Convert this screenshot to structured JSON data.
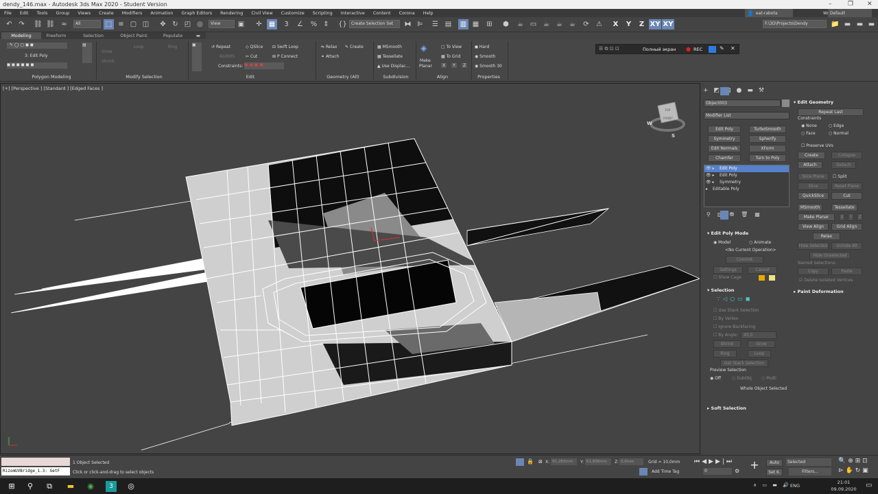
{
  "title": "dendy_146.max - Autodesk 3ds Max 2020 - Student Version",
  "menu": [
    "File",
    "Edit",
    "Tools",
    "Group",
    "Views",
    "Create",
    "Modifiers",
    "Animation",
    "Graph Editors",
    "Rendering",
    "Civil View",
    "Customize",
    "Scripting",
    "Interactive",
    "Content",
    "Corona",
    "Help"
  ],
  "user": "eat-rabota",
  "workspaces_label": "Workspaces:",
  "workspace": "Default",
  "toolbar": {
    "filter_all": "All",
    "view_select": "View",
    "sel_set": "Create Selection Set",
    "path": "F:\\3D\\Projects\\Dendy",
    "axis_x": "X",
    "axis_y": "Y",
    "axis_z": "Z",
    "axis_xy": "XY",
    "axis_xy2": "XY"
  },
  "ribbon_tabs": [
    "Modeling",
    "Freeform",
    "Selection",
    "Object Paint",
    "Populate"
  ],
  "ribbon": {
    "edit_poly_label": "3: Edit Poly",
    "grow": "Grow",
    "shrink": "Shrink",
    "loop": "Loop",
    "ring": "Ring",
    "repeat": "Repeat",
    "qslice": "QSlice",
    "swift_loop": "Swift Loop",
    "nurms": "NURMS",
    "cut": "Cut",
    "pconnect": "P Connect",
    "constraints": "Constraints:",
    "relax": "Relax",
    "create": "Create",
    "attach": "Attach",
    "msmooth": "MSmooth",
    "tessellate": "Tessellate",
    "use_displac": "Use Displac...",
    "make_planar_1": "Make",
    "make_planar_2": "Planar",
    "to_view": "To View",
    "to_grid": "To Grid",
    "x": "X",
    "y": "Y",
    "z": "Z",
    "hard": "Hard",
    "smooth": "Smooth",
    "smooth30": "Smooth 30",
    "sections": {
      "poly": "Polygon Modeling",
      "modsel": "Modify Selection",
      "edit": "Edit",
      "geom": "Geometry (All)",
      "subdiv": "Subdivision",
      "align": "Align",
      "props": "Properties"
    }
  },
  "rec": {
    "fullscreen": "Полный экран",
    "rec": "REC"
  },
  "viewport_label": "[+] [Perspective ] [Standard ] [Edged Faces ]",
  "viewcube": {
    "top": "TOP",
    "front": "FRONT",
    "w": "W",
    "s": "S"
  },
  "cmd": {
    "object_name": "Object003",
    "modifier_list": "Modifier List",
    "mod_buttons": [
      "Edit Poly",
      "TurboSmooth",
      "Symmetry",
      "Spherify",
      "Edit Normals",
      "XForm",
      "Chamfer",
      "Turn to Poly"
    ],
    "stack": [
      "Edit Poly",
      "Edit Poly",
      "Symmetry",
      "Editable Poly"
    ],
    "edit_poly_mode": "Edit Poly Mode",
    "model": "Model",
    "animate": "Animate",
    "no_op": "<No Current Operation>",
    "commit": "Commit",
    "settings": "Settings",
    "cancel": "Cancel",
    "show_cage": "Show Cage",
    "selection": "Selection",
    "use_stack": "Use Stack Selection",
    "by_vertex": "By Vertex",
    "ignore_backfacing": "Ignore Backfacing",
    "by_angle": "By Angle:",
    "angle_val": "45,0",
    "shrink": "Shrink",
    "grow": "Grow",
    "ring": "Ring",
    "loop": "Loop",
    "get_stack": "Get Stack Selection",
    "preview": "Preview Selection",
    "off": "Off",
    "subobj": "SubObj",
    "multi": "Multi",
    "whole": "Whole Object Selected",
    "soft": "Soft Selection",
    "edit_geom": "Edit Geometry",
    "repeat_last": "Repeat Last",
    "constraints": "Constraints",
    "none": "None",
    "edge": "Edge",
    "face": "Face",
    "normal": "Normal",
    "preserve_uvs": "Preserve UVs",
    "create": "Create",
    "collapse": "Collapse",
    "attach": "Attach",
    "detach": "Detach",
    "slice_plane": "Slice Plane",
    "split": "Split",
    "slice": "Slice",
    "reset_plane": "Reset Plane",
    "quickslice": "QuickSlice",
    "cut": "Cut",
    "msmooth": "MSmooth",
    "tessellate": "Tessellate",
    "make_planar": "Make Planar",
    "x": "X",
    "y": "Y",
    "z": "Z",
    "view_align": "View Align",
    "grid_align": "Grid Align",
    "relax": "Relax",
    "hide_selected": "Hide Selected",
    "unhide_all": "Unhide All",
    "hide_unselected": "Hide Unselected",
    "named_sel": "Named Selections:",
    "copy": "Copy",
    "paste": "Paste",
    "delete_isolated": "Delete Isolated Vertices",
    "paint_def": "Paint Deformation"
  },
  "status": {
    "script": "RizomUVBridge_1.3: GetF",
    "selected": "1 Object Selected",
    "hint": "Click or click-and-drag to select objects",
    "x_label": "X:",
    "x_val": "91,283mm",
    "y_label": "Y:",
    "y_val": "61,836mm",
    "z_label": "Z:",
    "z_val": "0,0mm",
    "grid": "Grid = 10,0mm",
    "add_time_tag": "Add Time Tag",
    "frame": "0",
    "auto": "Auto",
    "selected_dd": "Selected",
    "setk": "Set K.",
    "filters": "Filters..."
  },
  "taskbar": {
    "lang": "ENG",
    "time": "21:01",
    "date": "09.09.2020"
  }
}
